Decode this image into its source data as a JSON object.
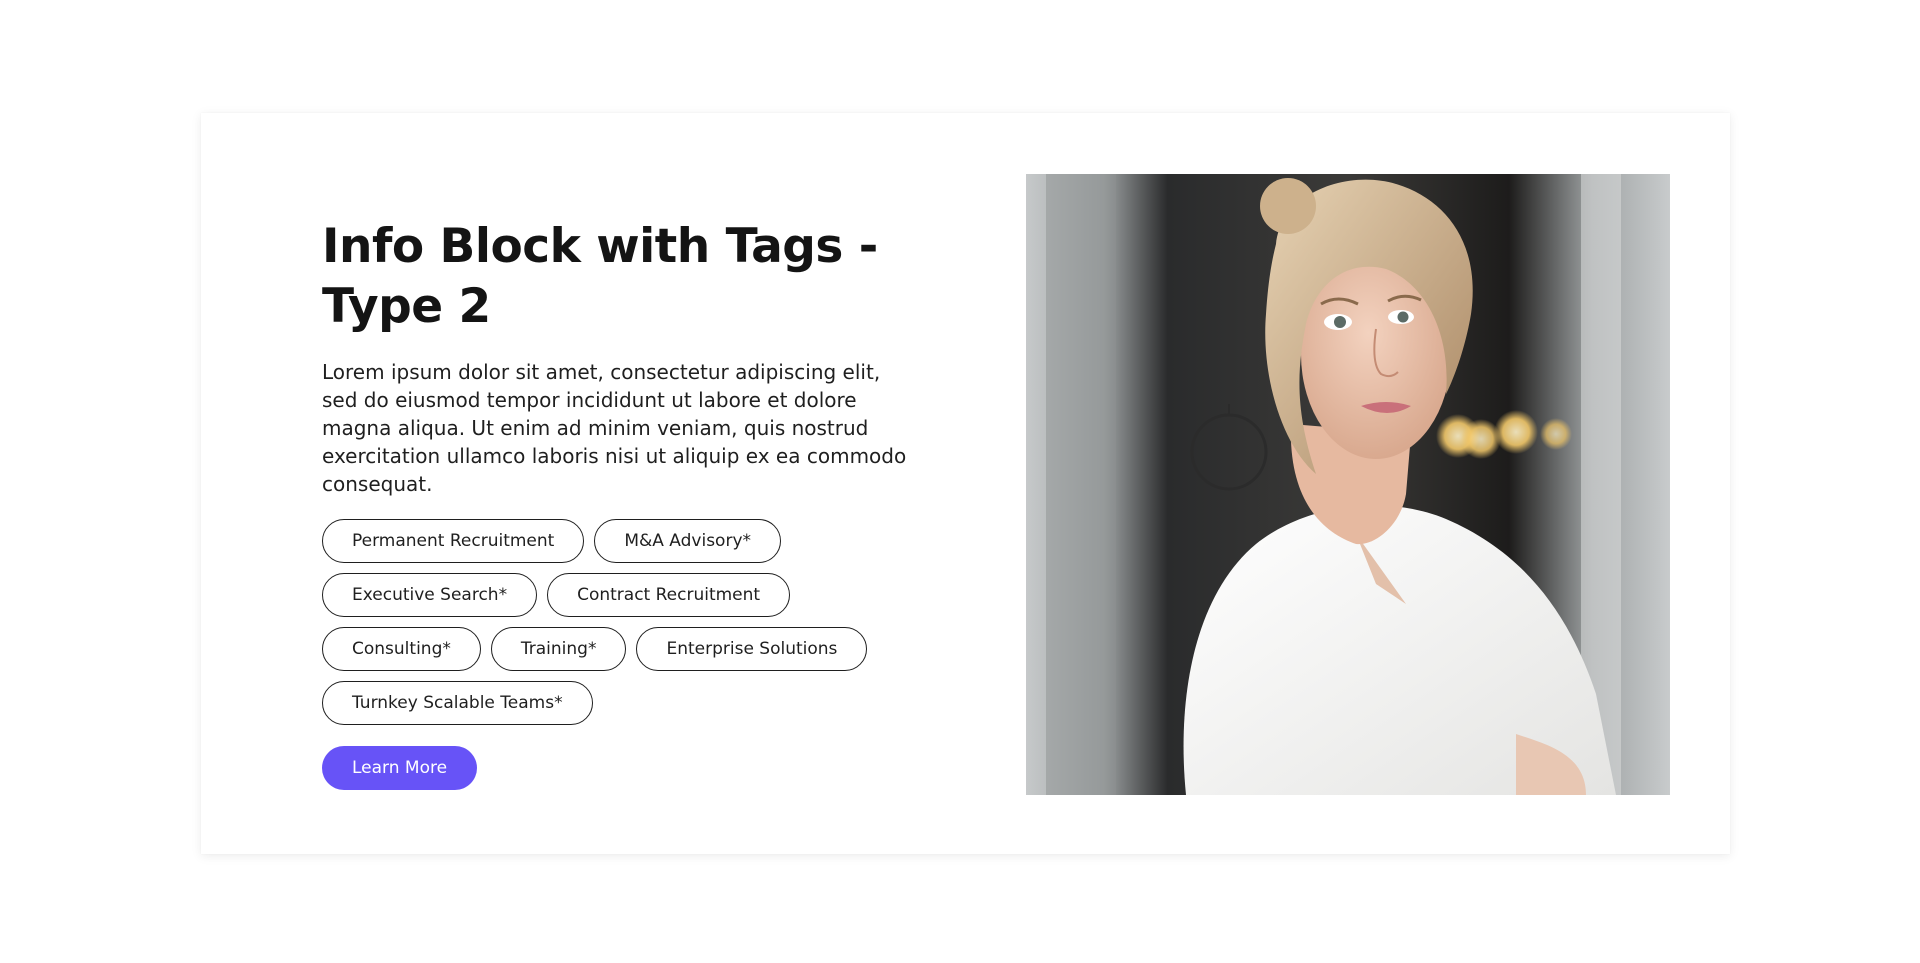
{
  "info_block": {
    "title": "Info Block with Tags - Type 2",
    "description": "Lorem ipsum dolor sit amet, consectetur adipiscing elit, sed do eiusmod tempor incididunt ut labore et dolore magna aliqua. Ut enim ad minim veniam, quis nostrud exercitation ullamco laboris nisi ut aliquip ex ea commodo consequat.",
    "tags": [
      "Permanent Recruitment",
      "M&A Advisory*",
      "Executive Search*",
      "Contract Recruitment",
      "Consulting*",
      "Training*",
      "Enterprise Solutions",
      "Turnkey Scalable Teams*"
    ],
    "cta_label": "Learn More"
  },
  "colors": {
    "accent": "#6753f7",
    "text": "#141414",
    "tag_border": "#1f1f1f",
    "background": "#ffffff"
  }
}
